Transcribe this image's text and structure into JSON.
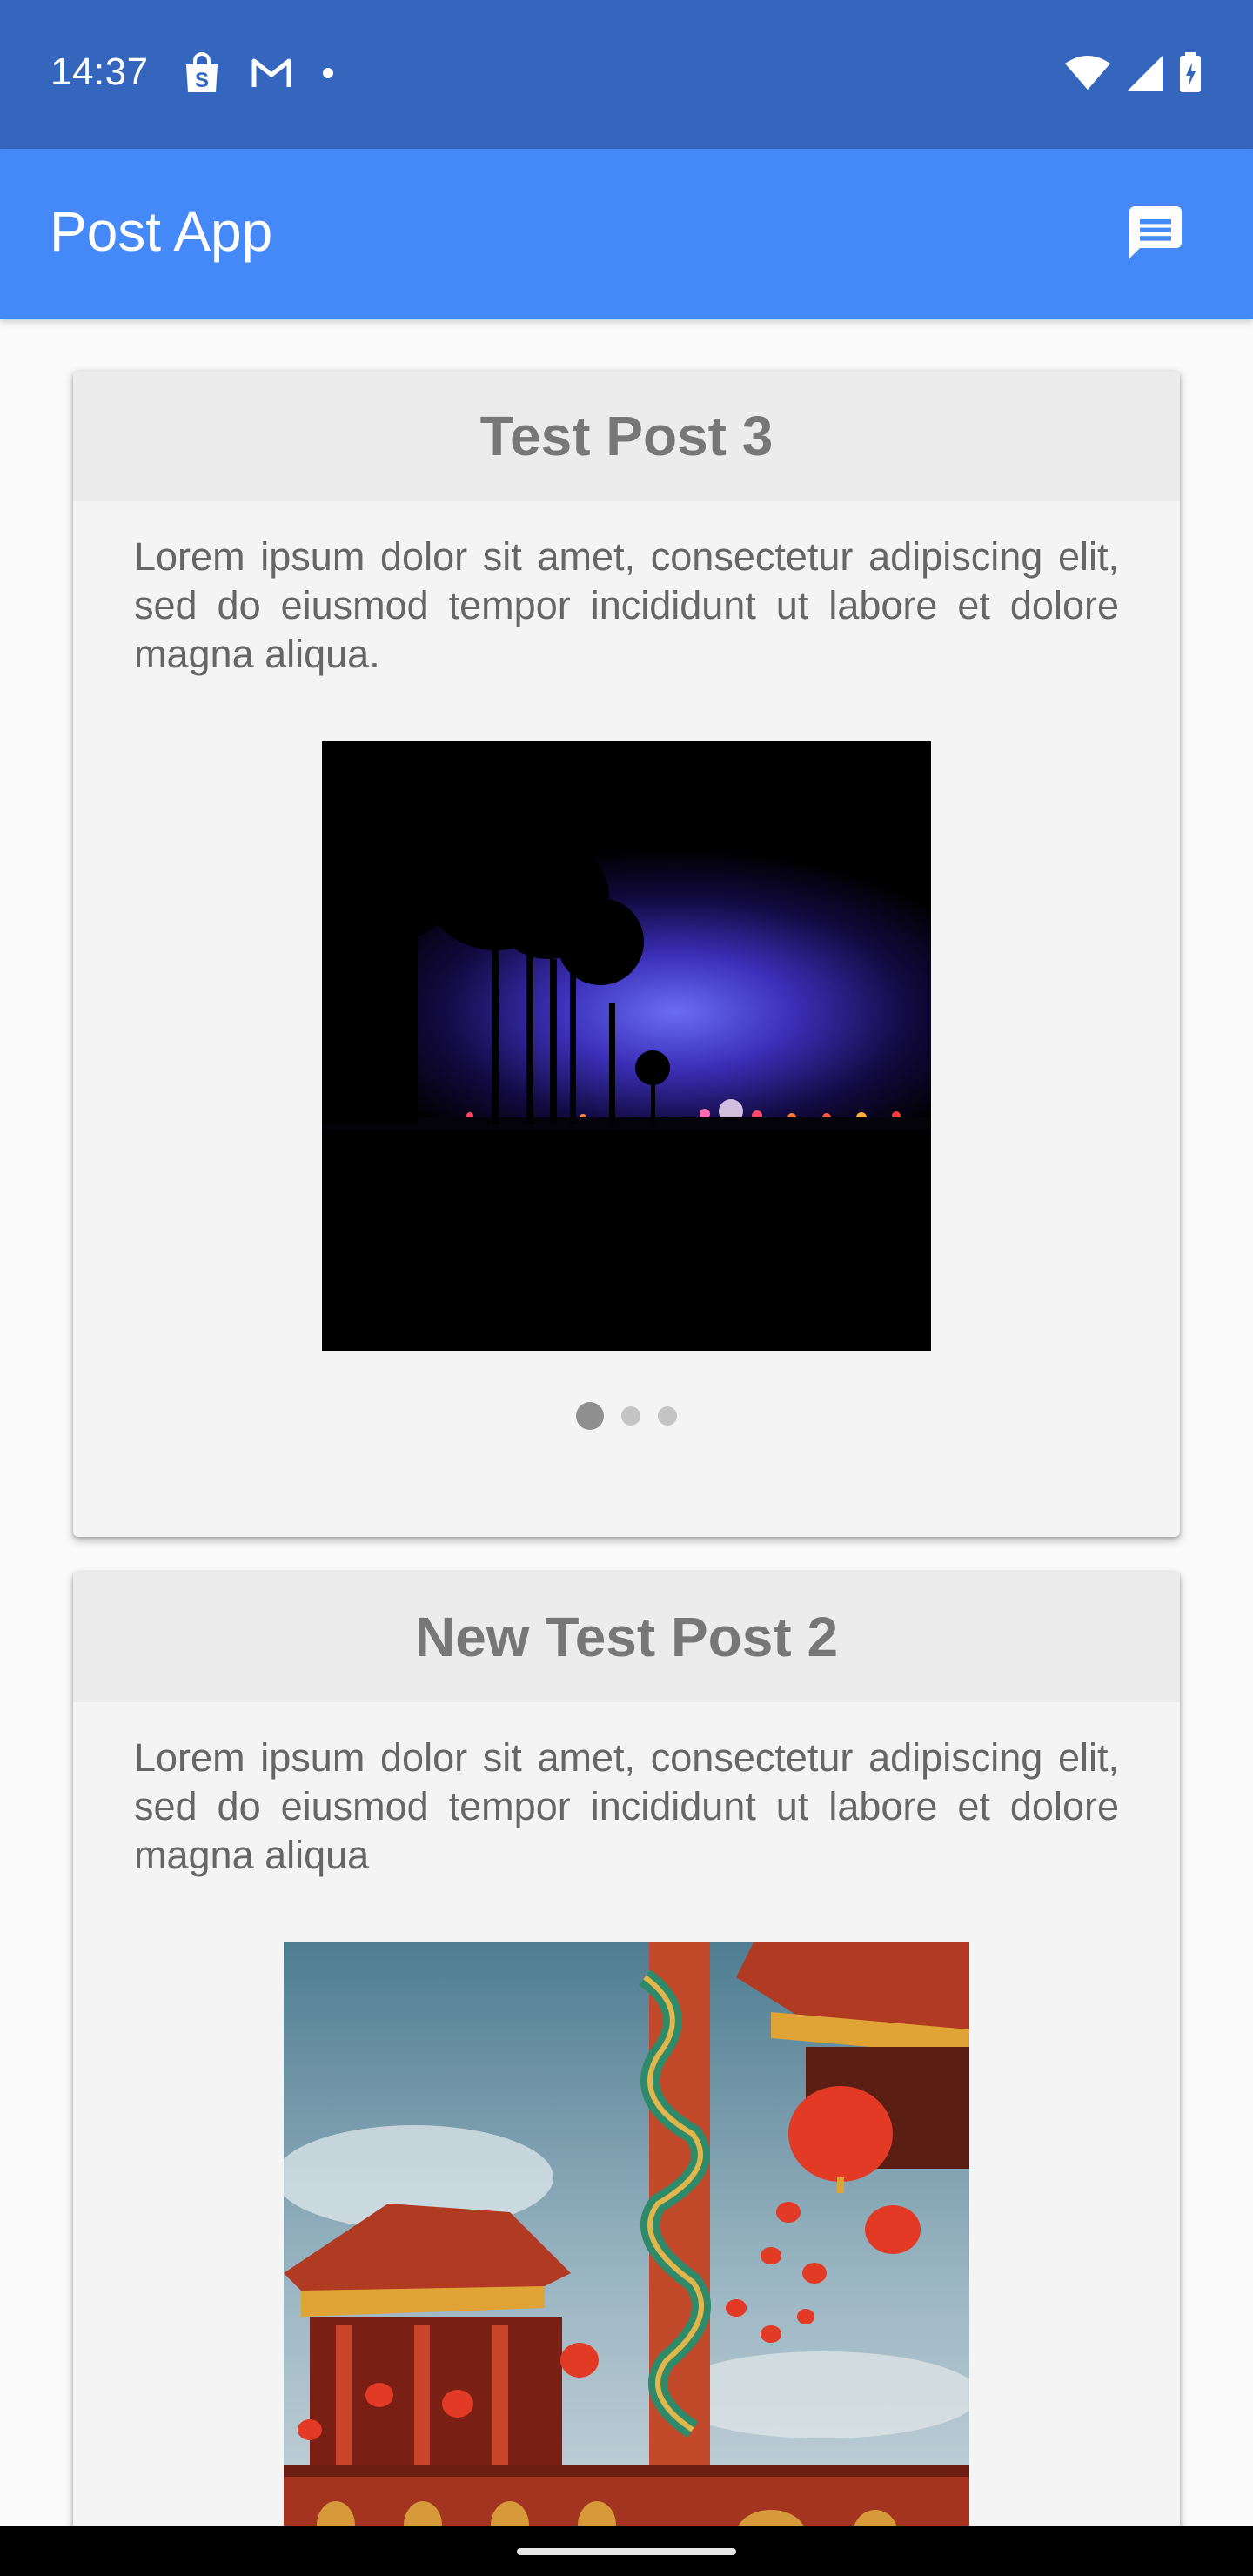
{
  "status_bar": {
    "time": "14:37",
    "icons_left": [
      "shopping-bag-icon",
      "gmail-icon",
      "notification-dot-icon"
    ],
    "icons_right": [
      "wifi-icon",
      "signal-icon",
      "battery-charging-icon"
    ],
    "background": "#3566bd"
  },
  "app_bar": {
    "title": "Post App",
    "action_icon": "chat-message-icon",
    "background": "#4489f7"
  },
  "posts": [
    {
      "title": "Test Post 3",
      "body": "Lorem ipsum dolor sit amet, consectetur adipiscing elit, sed do eiusmod tempor incididunt ut labore et dolore magna aliqua.",
      "image": "night-palm-trees-photo",
      "carousel_pages": 3,
      "carousel_active": 1
    },
    {
      "title": "New Test Post 2",
      "body": "Lorem ipsum dolor sit amet, consectetur adipiscing elit, sed do eiusmod tempor incididunt ut labore et dolore magna aliqua",
      "image": "chinese-temple-lanterns-photo"
    }
  ]
}
